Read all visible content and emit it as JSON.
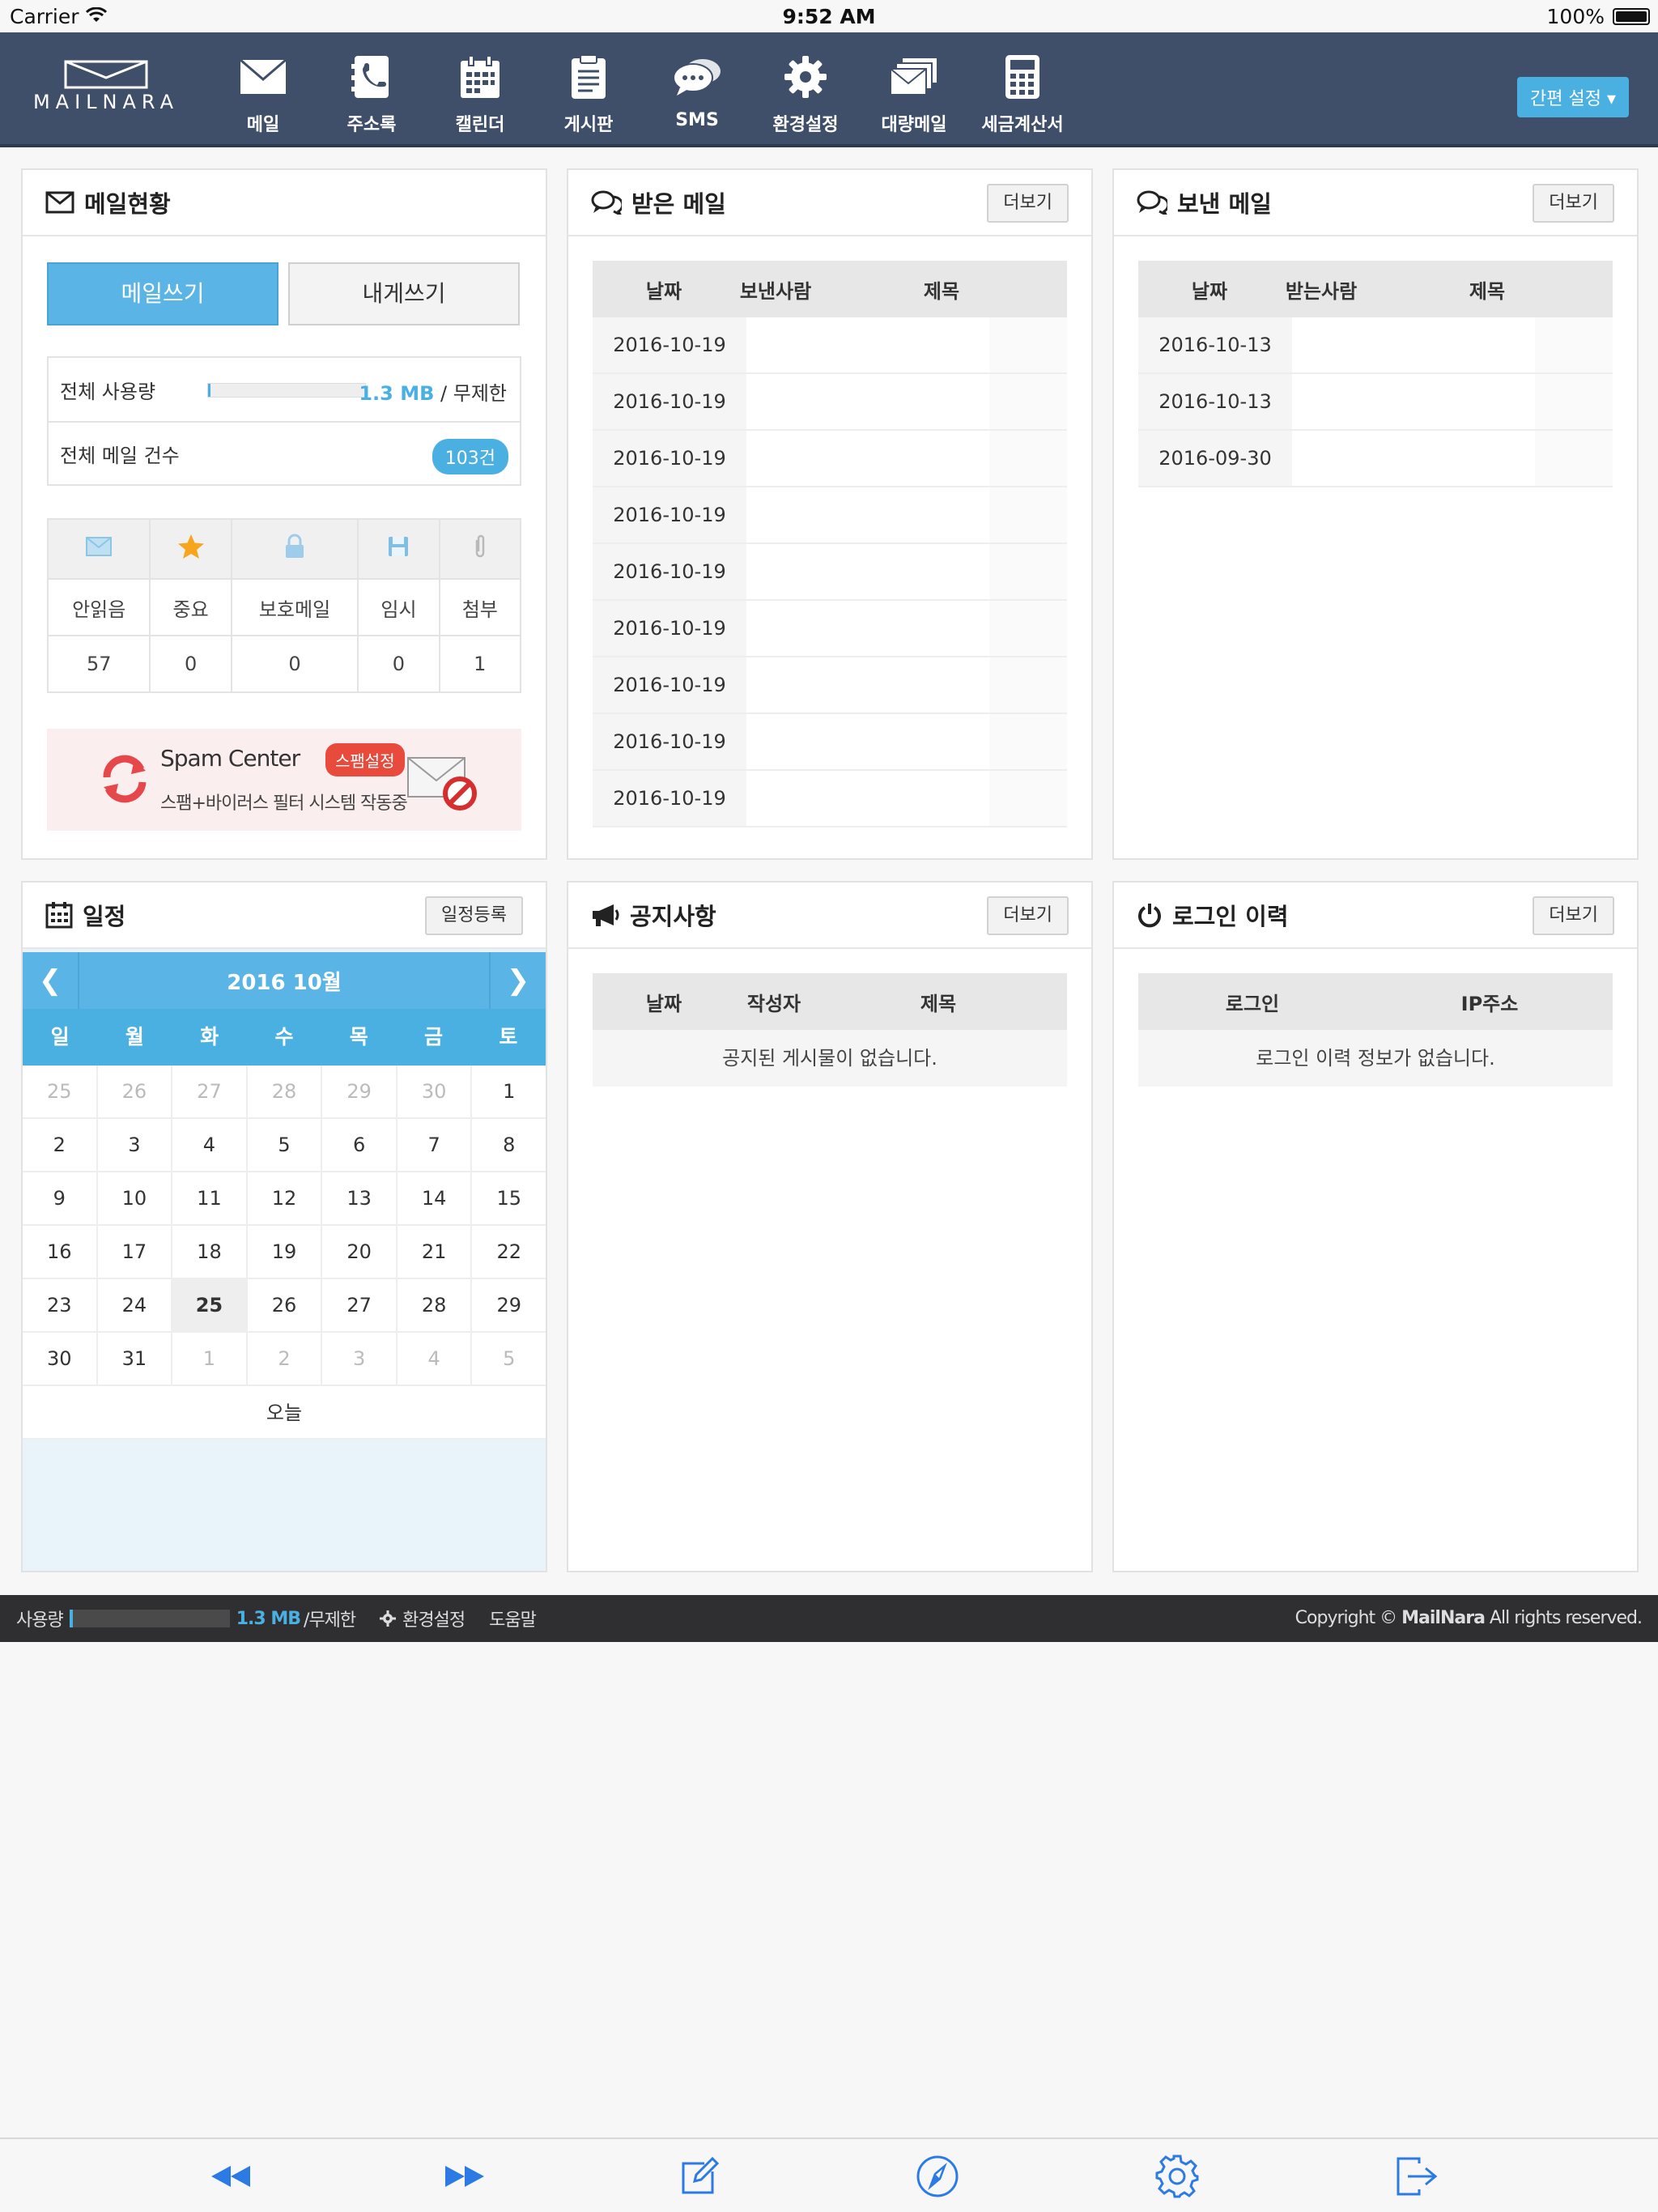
{
  "status": {
    "carrier": "Carrier",
    "time": "9:52 AM",
    "battery": "100%"
  },
  "logo": {
    "text": "MAILNARA"
  },
  "nav": {
    "items": [
      {
        "label": "메일",
        "icon": "envelope-icon"
      },
      {
        "label": "주소록",
        "icon": "address-book-icon"
      },
      {
        "label": "캘린더",
        "icon": "calendar-icon"
      },
      {
        "label": "게시판",
        "icon": "clipboard-icon"
      },
      {
        "label": "SMS",
        "icon": "chat-bubble-icon"
      },
      {
        "label": "환경설정",
        "icon": "gear-icon"
      },
      {
        "label": "대량메일",
        "icon": "mass-mail-icon"
      },
      {
        "label": "세금계산서",
        "icon": "calculator-icon"
      }
    ],
    "quick_settings": "간편 설정 ▾"
  },
  "mail_status": {
    "title": "메일현황",
    "write_label": "메일쓰기",
    "self_write_label": "내게쓰기",
    "usage_label": "전체 사용량",
    "usage_value": "1.3 MB",
    "usage_limit": " / 무제한",
    "usage_fraction": 0.01,
    "count_label": "전체 메일 건수",
    "count_value": "103건",
    "stats_labels": [
      "안읽음",
      "중요",
      "보호메일",
      "임시",
      "첨부"
    ],
    "stats_values": [
      "57",
      "0",
      "0",
      "0",
      "1"
    ],
    "spam_title": "Spam Center",
    "spam_tag": "스팸설정",
    "spam_desc": "스팸+바이러스 필터 시스템 작동중"
  },
  "inbox": {
    "title": "받은 메일",
    "more": "더보기",
    "headers": [
      "날짜",
      "보낸사람",
      "제목"
    ],
    "dates": [
      "2016-10-19",
      "2016-10-19",
      "2016-10-19",
      "2016-10-19",
      "2016-10-19",
      "2016-10-19",
      "2016-10-19",
      "2016-10-19",
      "2016-10-19"
    ]
  },
  "sent": {
    "title": "보낸 메일",
    "more": "더보기",
    "headers": [
      "날짜",
      "받는사람",
      "제목"
    ],
    "dates": [
      "2016-10-13",
      "2016-10-13",
      "2016-09-30"
    ]
  },
  "schedule": {
    "title": "일정",
    "register": "일정등록",
    "month": "2016 10월",
    "weekdays": [
      "일",
      "월",
      "화",
      "수",
      "목",
      "금",
      "토"
    ],
    "weeks": [
      [
        "25",
        "26",
        "27",
        "28",
        "29",
        "30",
        "1"
      ],
      [
        "2",
        "3",
        "4",
        "5",
        "6",
        "7",
        "8"
      ],
      [
        "9",
        "10",
        "11",
        "12",
        "13",
        "14",
        "15"
      ],
      [
        "16",
        "17",
        "18",
        "19",
        "20",
        "21",
        "22"
      ],
      [
        "23",
        "24",
        "25",
        "26",
        "27",
        "28",
        "29"
      ],
      [
        "30",
        "31",
        "1",
        "2",
        "3",
        "4",
        "5"
      ]
    ],
    "today_label": "오늘"
  },
  "notice": {
    "title": "공지사항",
    "more": "더보기",
    "headers": [
      "날짜",
      "작성자",
      "제목"
    ],
    "empty": "공지된 게시물이 없습니다."
  },
  "login_history": {
    "title": "로그인 이력",
    "more": "더보기",
    "headers": [
      "로그인",
      "IP주소"
    ],
    "empty": "로그인 이력 정보가 없습니다."
  },
  "footer": {
    "usage_label": "사용량",
    "usage_value": "1.3 MB",
    "usage_limit": "/무제한",
    "settings": "환경설정",
    "help": "도움말",
    "copyright_pre": "Copyright © ",
    "copyright_brand": "MailNara",
    "copyright_post": " All rights reserved."
  },
  "colors": {
    "navbar": "#3f4f69",
    "accent": "#4ab0e2",
    "spam_tag": "#e84a3c",
    "footer": "#2f2f31"
  },
  "toolbar": [
    "back-icon",
    "forward-icon",
    "compose-icon",
    "compass-icon",
    "gear-icon",
    "logout-icon"
  ]
}
